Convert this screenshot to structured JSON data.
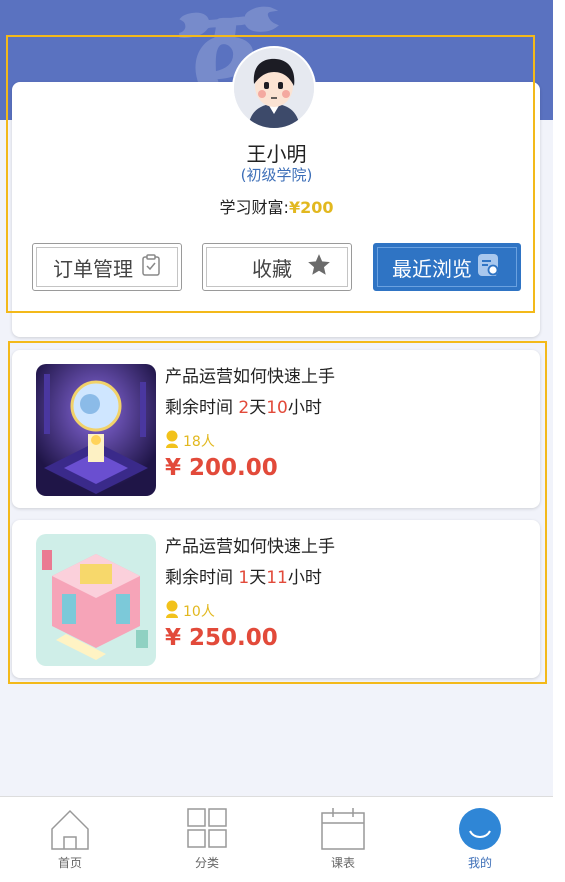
{
  "profile": {
    "name": "王小明",
    "level": "(初级学院)",
    "wealth_label": "学习财富:",
    "wealth_amount": "¥200"
  },
  "actions": {
    "orders": {
      "label": "订单管理",
      "icon": "clipboard-check-icon"
    },
    "favorites": {
      "label": "收藏",
      "icon": "star-icon"
    },
    "recent": {
      "label": "最近浏览",
      "icon": "document-search-icon"
    }
  },
  "courses": [
    {
      "title": "产品运营如何快速上手",
      "time_prefix": "剩余时间 ",
      "days": "2",
      "days_unit": "天",
      "hours": "10",
      "hours_unit": "小时",
      "people": "18人",
      "price": "¥ 200.00"
    },
    {
      "title": "产品运营如何快速上手",
      "time_prefix": "剩余时间 ",
      "days": "1",
      "days_unit": "天",
      "hours": "11",
      "hours_unit": "小时",
      "people": "10人",
      "price": "¥ 250.00"
    }
  ],
  "tabbar": [
    {
      "label": "首页",
      "icon": "home-icon"
    },
    {
      "label": "分类",
      "icon": "grid-icon"
    },
    {
      "label": "课表",
      "icon": "calendar-icon"
    },
    {
      "label": "我的",
      "icon": "profile-smile-icon",
      "active": true
    }
  ],
  "colors": {
    "header_blue": "#5a72c0",
    "accent_blue": "#2f74c4",
    "price_red": "#e24a3a",
    "wealth_gold": "#e2b81f",
    "highlight_frame": "#f3b91a"
  }
}
